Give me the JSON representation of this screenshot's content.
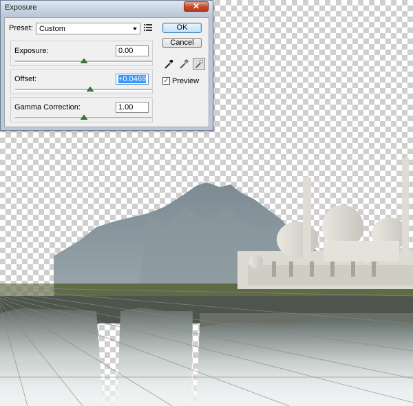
{
  "dialog": {
    "title": "Exposure",
    "close_glyph": "✕",
    "preset_label": "Preset:",
    "preset_value": "Custom",
    "exposure": {
      "label": "Exposure:",
      "value": "0.00",
      "slider_fraction": 0.5
    },
    "offset": {
      "label": "Offset:",
      "value": "+0.0469",
      "slider_fraction": 0.55
    },
    "gamma": {
      "label": "Gamma Correction:",
      "value": "1.00",
      "slider_fraction": 0.5
    },
    "ok_label": "OK",
    "cancel_label": "Cancel",
    "preview_label": "Preview",
    "preview_checked": true,
    "preview_check_glyph": "✓"
  },
  "colors": {
    "selection": "#3399ff",
    "ok_accent": "#3c7fb1",
    "close_button": "#c4472a"
  },
  "icons": [
    "preset-menu-icon",
    "black-eyedropper-icon",
    "gray-eyedropper-icon",
    "white-eyedropper-icon",
    "slider-triangle-icon"
  ]
}
